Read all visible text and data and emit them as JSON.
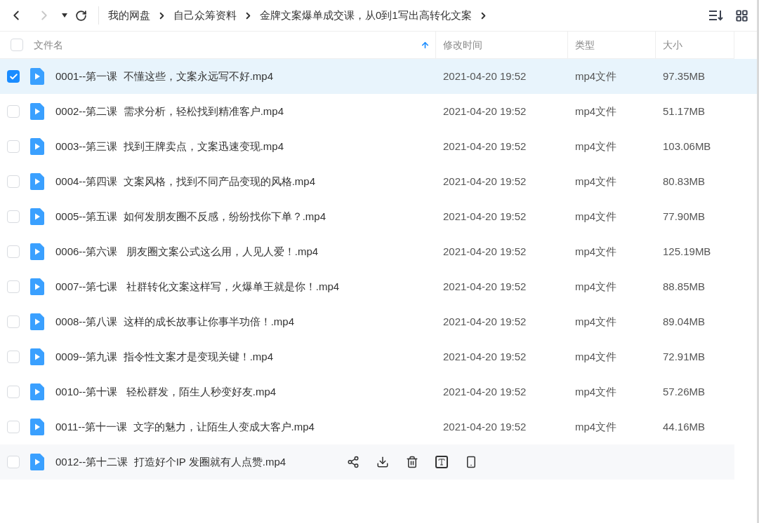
{
  "nav": {
    "back_disabled": false,
    "forward_disabled": true
  },
  "breadcrumb": [
    "我的网盘",
    "自己众筹资料",
    "金牌文案爆单成交课，从0到1写出高转化文案"
  ],
  "table": {
    "all_checked": false,
    "columns": [
      {
        "label": "文件名",
        "sorted": true
      },
      {
        "label": "修改时间",
        "sorted": false
      },
      {
        "label": "类型",
        "sorted": false
      },
      {
        "label": "大小",
        "sorted": false
      }
    ],
    "rows": [
      {
        "name": "0001--第一课  不懂这些，文案永远写不好.mp4",
        "time": "2021-04-20 19:52",
        "type": "mp4文件",
        "size": "97.35MB",
        "selected": true,
        "hovered": false
      },
      {
        "name": "0002--第二课  需求分析，轻松找到精准客户.mp4",
        "time": "2021-04-20 19:52",
        "type": "mp4文件",
        "size": "51.17MB",
        "selected": false,
        "hovered": false
      },
      {
        "name": "0003--第三课  找到王牌卖点，文案迅速变现.mp4",
        "time": "2021-04-20 19:52",
        "type": "mp4文件",
        "size": "103.06MB",
        "selected": false,
        "hovered": false
      },
      {
        "name": "0004--第四课  文案风格，找到不同产品变现的风格.mp4",
        "time": "2021-04-20 19:52",
        "type": "mp4文件",
        "size": "80.83MB",
        "selected": false,
        "hovered": false
      },
      {
        "name": "0005--第五课  如何发朋友圈不反感，纷纷找你下单？.mp4",
        "time": "2021-04-20 19:52",
        "type": "mp4文件",
        "size": "77.90MB",
        "selected": false,
        "hovered": false
      },
      {
        "name": "0006--第六课   朋友圈文案公式这么用，人见人爱！.mp4",
        "time": "2021-04-20 19:52",
        "type": "mp4文件",
        "size": "125.19MB",
        "selected": false,
        "hovered": false
      },
      {
        "name": "0007--第七课   社群转化文案这样写，火爆单王就是你！.mp4",
        "time": "2021-04-20 19:52",
        "type": "mp4文件",
        "size": "88.85MB",
        "selected": false,
        "hovered": false
      },
      {
        "name": "0008--第八课  这样的成长故事让你事半功倍！.mp4",
        "time": "2021-04-20 19:52",
        "type": "mp4文件",
        "size": "89.04MB",
        "selected": false,
        "hovered": false
      },
      {
        "name": "0009--第九课  指令性文案才是变现关键！.mp4",
        "time": "2021-04-20 19:52",
        "type": "mp4文件",
        "size": "72.91MB",
        "selected": false,
        "hovered": false
      },
      {
        "name": "0010--第十课   轻松群发，陌生人秒变好友.mp4",
        "time": "2021-04-20 19:52",
        "type": "mp4文件",
        "size": "57.26MB",
        "selected": false,
        "hovered": false
      },
      {
        "name": "0011--第十一课  文字的魅力，让陌生人变成大客户.mp4",
        "time": "2021-04-20 19:52",
        "type": "mp4文件",
        "size": "44.16MB",
        "selected": false,
        "hovered": false
      },
      {
        "name": "0012--第十二课  打造好个IP 发圈就有人点赞.mp4",
        "selected": false,
        "hovered": true
      }
    ]
  }
}
